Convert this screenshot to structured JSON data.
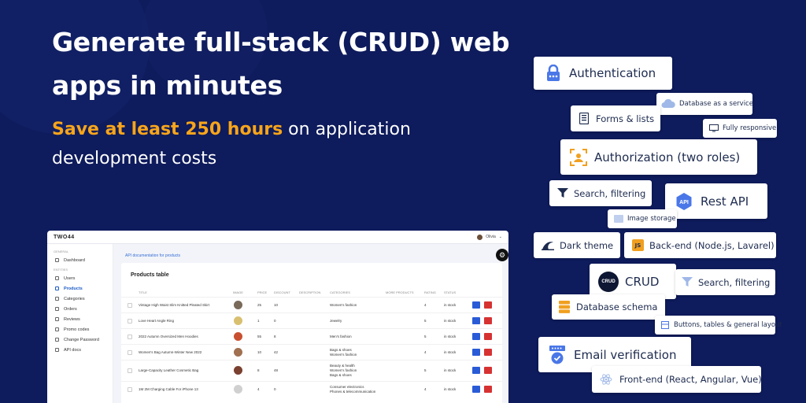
{
  "headline": "Generate full-stack (CRUD) web apps in minutes",
  "subline": {
    "pre": "Save at least ",
    "hl": "250 hours",
    "post": " on application development costs"
  },
  "app": {
    "logo": "TWO44",
    "user": "Olivia",
    "sidebar": {
      "general_heading": "GENERAL",
      "entities_heading": "ENTITIES",
      "dashboard": "Dashboard",
      "items": [
        "Users",
        "Products",
        "Categories",
        "Orders",
        "Reviews",
        "Promo codes",
        "Change Password",
        "API docs"
      ]
    },
    "api_link": "API documentation for products",
    "table_title": "Products table",
    "columns": [
      "TITLE",
      "IMAGE",
      "PRICE",
      "DISCOUNT",
      "DESCRIPTION",
      "CATEGORIES",
      "MORE PRODUCTS",
      "RATING",
      "STATUS"
    ],
    "rows": [
      {
        "title": "Vintage High Waist Slim Knitted Pleated Skirt",
        "price": "25",
        "discount": "10",
        "cat1": "Women's fashion",
        "cat2": "",
        "rating": "4",
        "status": "in stock"
      },
      {
        "title": "Love Heart Angle Ring",
        "price": "1",
        "discount": "0",
        "cat1": "Jewelry",
        "cat2": "",
        "rating": "5",
        "status": "in stock"
      },
      {
        "title": "2022 Autumn Oversized Men Hoodies",
        "price": "55",
        "discount": "8",
        "cat1": "Men's fashion",
        "cat2": "",
        "rating": "5",
        "status": "in stock"
      },
      {
        "title": "Women's Bag Autumn-Winter New 2022",
        "price": "10",
        "discount": "42",
        "cat1": "Bags & shoes",
        "cat2": "Women's fashion",
        "rating": "4",
        "status": "in stock"
      },
      {
        "title": "Large-Capacity Leather Cosmetic Bag",
        "price": "8",
        "discount": "48",
        "cat1": "Beauty & health",
        "cat2": "Women's fashion",
        "cat3": "Bags & shoes",
        "rating": "5",
        "status": "in stock"
      },
      {
        "title": "1M 2M Charging Cable For iPhone 13",
        "price": "4",
        "discount": "0",
        "cat1": "Consumer electronics",
        "cat2": "Phones & telecommunication",
        "rating": "4",
        "status": "in stock"
      }
    ]
  },
  "features": {
    "authentication": "Authentication",
    "db_service": "Database as a service",
    "forms": "Forms & lists",
    "responsive": "Fully responsive",
    "authorization": "Authorization (two roles)",
    "search1": "Search, filtering",
    "rest": "Rest API",
    "image_storage": "Image storage",
    "dark": "Dark theme",
    "backend": "Back-end (Node.js, Lavarel)",
    "crud": "CRUD",
    "crud_badge": "CRUD",
    "search2": "Search, filtering",
    "dbschema": "Database schema",
    "buttons": "Buttons, tables & general layout",
    "email": "Email verification",
    "frontend": "Front-end (React, Angular, Vue)",
    "api_badge": "API",
    "js_badge": "JS"
  },
  "colors": {
    "background": "#0e1b5c",
    "accent": "#f8a51b",
    "primary": "#1d5cc7",
    "danger": "#d63232"
  }
}
